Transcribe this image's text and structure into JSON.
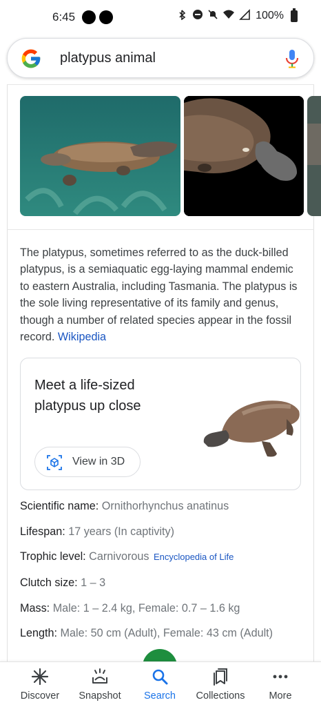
{
  "status_bar": {
    "time": "6:45",
    "battery": "100%"
  },
  "search": {
    "query": "platypus animal"
  },
  "description": {
    "text": "The platypus, sometimes referred to as the duck-billed platypus, is a semiaquatic egg-laying mammal endemic to eastern Australia, including Tasmania. The platypus is the sole living representative of its family and genus, though a number of related species appear in the fossil record.",
    "source_link": "Wikipedia"
  },
  "card3d": {
    "title": "Meet a life-sized platypus up close",
    "button_label": "View in 3D"
  },
  "facts": [
    {
      "label": "Scientific name:",
      "value": "Ornithorhynchus anatinus",
      "source": ""
    },
    {
      "label": "Lifespan:",
      "value": "17 years (In captivity)",
      "source": ""
    },
    {
      "label": "Trophic level:",
      "value": "Carnivorous",
      "source": "Encyclopedia of Life"
    },
    {
      "label": "Clutch size:",
      "value": "1 – 3",
      "source": ""
    },
    {
      "label": "Mass:",
      "value": "Male: 1 – 2.4 kg, Female: 0.7 – 1.6 kg",
      "source": ""
    },
    {
      "label": "Length:",
      "value": "Male: 50 cm (Adult), Female: 43 cm (Adult)",
      "source": ""
    }
  ],
  "bottom_nav": [
    {
      "label": "Discover",
      "icon": "asterisk-icon"
    },
    {
      "label": "Snapshot",
      "icon": "snapshot-icon"
    },
    {
      "label": "Search",
      "icon": "search-icon",
      "active": true
    },
    {
      "label": "Collections",
      "icon": "collections-icon"
    },
    {
      "label": "More",
      "icon": "more-icon"
    }
  ],
  "colors": {
    "accent": "#1a73e8",
    "link": "#1a56c2",
    "fab": "#1e8e3e"
  }
}
